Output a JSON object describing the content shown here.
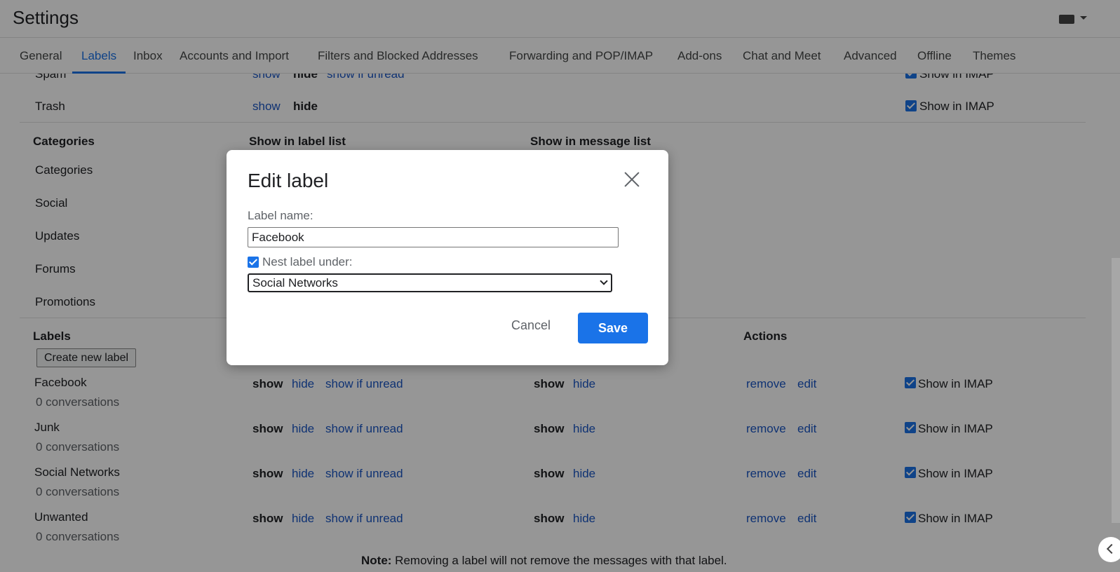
{
  "header": {
    "title": "Settings",
    "keyboard_icon": "keyboard-icon"
  },
  "tabs": [
    {
      "label": "General"
    },
    {
      "label": "Labels"
    },
    {
      "label": "Inbox"
    },
    {
      "label": "Accounts and Import"
    },
    {
      "label": "Filters and Blocked Addresses"
    },
    {
      "label": "Forwarding and POP/IMAP"
    },
    {
      "label": "Add-ons"
    },
    {
      "label": "Chat and Meet"
    },
    {
      "label": "Advanced"
    },
    {
      "label": "Offline"
    },
    {
      "label": "Themes"
    }
  ],
  "active_tab": "Labels",
  "system_labels": {
    "spam": {
      "name": "Spam",
      "show": "show",
      "hide": "hide",
      "show_if_unread": "show if unread",
      "imap": "Show in IMAP"
    },
    "trash": {
      "name": "Trash",
      "show": "show",
      "hide": "hide",
      "imap": "Show in IMAP"
    }
  },
  "categories": {
    "heading": "Categories",
    "col_label_list": "Show in label list",
    "col_message_list": "Show in message list",
    "items": [
      "Categories",
      "Social",
      "Updates",
      "Forums",
      "Promotions"
    ]
  },
  "labels_section": {
    "heading": "Labels",
    "actions_heading": "Actions",
    "create_button": "Create new label",
    "rows": [
      {
        "name": "Facebook",
        "count": "0 conversations",
        "show": "show",
        "hide": "hide",
        "show_if_unread": "show if unread",
        "msg_show": "show",
        "msg_hide": "hide",
        "remove": "remove",
        "edit": "edit",
        "imap": "Show in IMAP"
      },
      {
        "name": "Junk",
        "count": "0 conversations",
        "show": "show",
        "hide": "hide",
        "show_if_unread": "show if unread",
        "msg_show": "show",
        "msg_hide": "hide",
        "remove": "remove",
        "edit": "edit",
        "imap": "Show in IMAP"
      },
      {
        "name": "Social Networks",
        "count": "0 conversations",
        "show": "show",
        "hide": "hide",
        "show_if_unread": "show if unread",
        "msg_show": "show",
        "msg_hide": "hide",
        "remove": "remove",
        "edit": "edit",
        "imap": "Show in IMAP"
      },
      {
        "name": "Unwanted",
        "count": "0 conversations",
        "show": "show",
        "hide": "hide",
        "show_if_unread": "show if unread",
        "msg_show": "show",
        "msg_hide": "hide",
        "remove": "remove",
        "edit": "edit",
        "imap": "Show in IMAP"
      }
    ],
    "note_bold": "Note:",
    "note_text": " Removing a label will not remove the messages with that label."
  },
  "dialog": {
    "title": "Edit label",
    "label_name_caption": "Label name:",
    "label_name_value": "Facebook",
    "nest_checked": true,
    "nest_caption": "Nest label under:",
    "nest_selected": "Social Networks",
    "cancel": "Cancel",
    "save": "Save"
  },
  "colors": {
    "accent": "#1a73e8",
    "link": "#1a56c4",
    "overlay": "rgba(0,0,0,0.41)"
  }
}
